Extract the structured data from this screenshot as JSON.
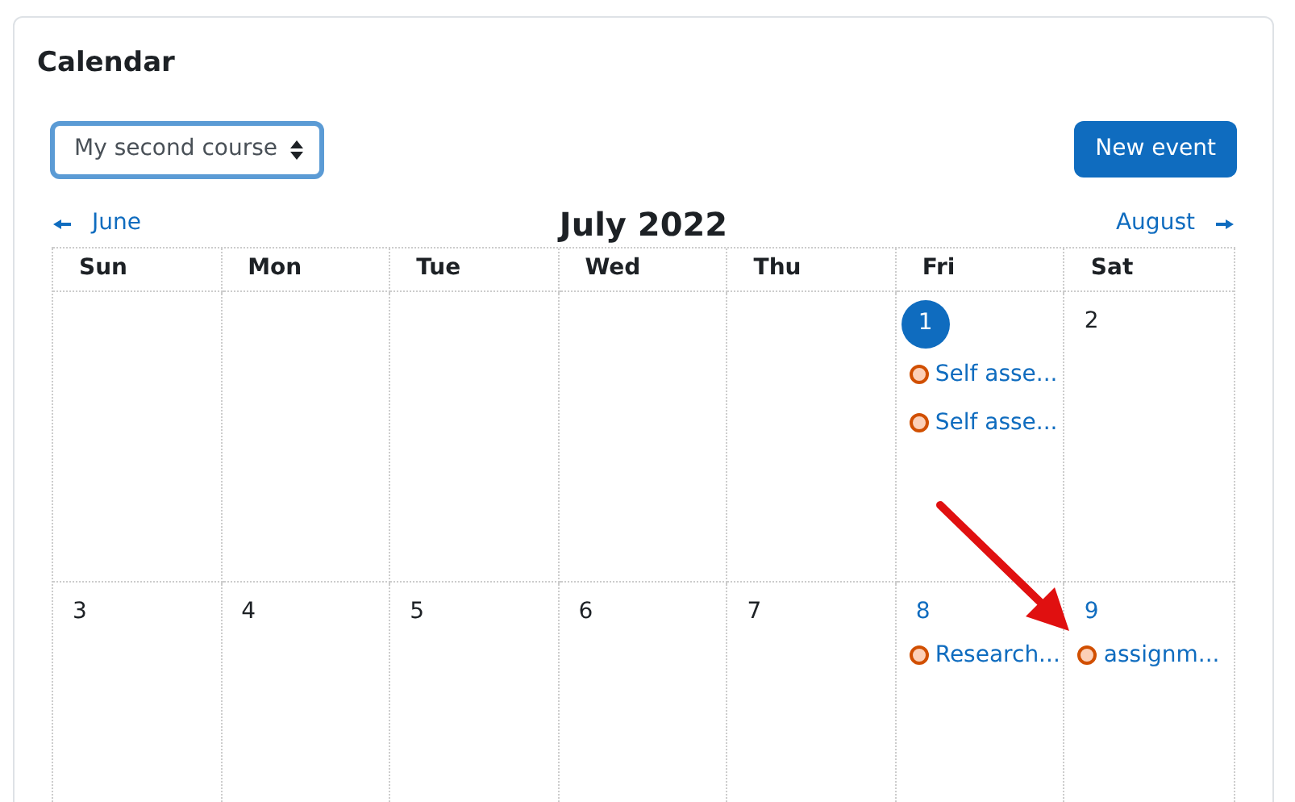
{
  "title": "Calendar",
  "course_select": {
    "value": "My second course",
    "focused": true
  },
  "new_event_button": "New event",
  "nav": {
    "previous": "June",
    "current": "July 2022",
    "next": "August"
  },
  "weekdays": [
    "Sun",
    "Mon",
    "Tue",
    "Wed",
    "Thu",
    "Fri",
    "Sat"
  ],
  "weeks": [
    {
      "days": [
        {
          "kind": "blank"
        },
        {
          "kind": "blank"
        },
        {
          "kind": "blank"
        },
        {
          "kind": "blank"
        },
        {
          "kind": "blank"
        },
        {
          "kind": "day",
          "number": "1",
          "today": true,
          "events": [
            "Self asse...",
            "Self asse..."
          ]
        },
        {
          "kind": "day",
          "number": "2",
          "today": false
        }
      ]
    },
    {
      "days": [
        {
          "kind": "day",
          "number": "3",
          "today": false
        },
        {
          "kind": "day",
          "number": "4",
          "today": false
        },
        {
          "kind": "day",
          "number": "5",
          "today": false
        },
        {
          "kind": "day",
          "number": "6",
          "today": false
        },
        {
          "kind": "day",
          "number": "7",
          "today": false
        },
        {
          "kind": "day",
          "number": "8",
          "today": false,
          "events": [
            "Research..."
          ]
        },
        {
          "kind": "day",
          "number": "9",
          "today": false,
          "events": [
            "assignm..."
          ]
        }
      ]
    }
  ]
}
